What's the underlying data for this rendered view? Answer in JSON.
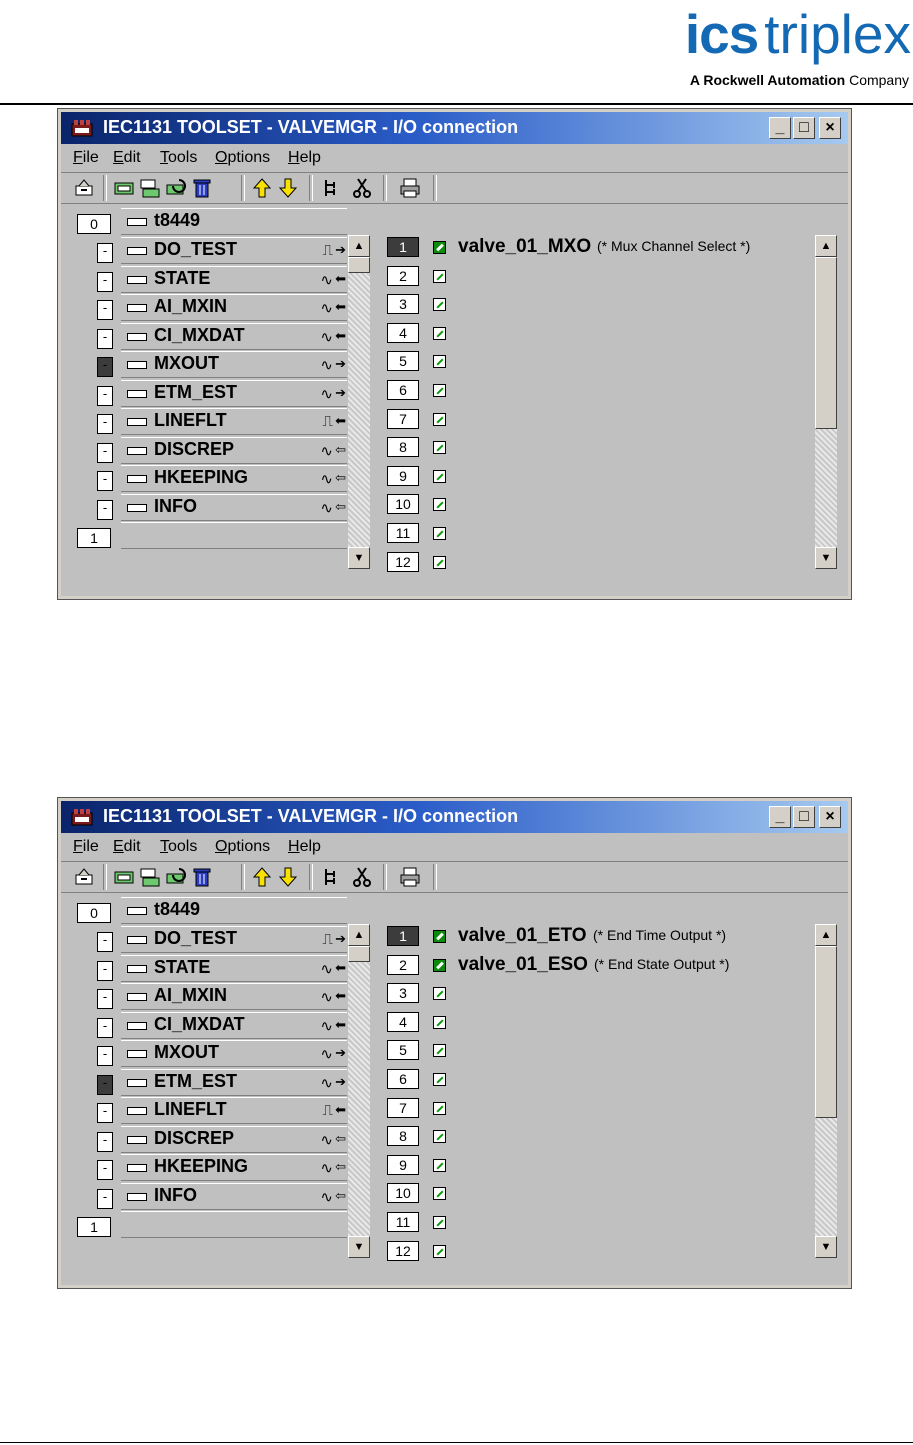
{
  "logo": {
    "brand_bold": "ics",
    "brand_light": "triplex",
    "tagline_bold": "A Rockwell Automation",
    "tagline_light": "Company"
  },
  "window_title": "IEC1131 TOOLSET - VALVEMGR - I/O connection",
  "window_buttons": {
    "minimize": "_",
    "maximize": "□",
    "close": "×"
  },
  "menu": [
    "File",
    "Edit",
    "Tools",
    "Options",
    "Help"
  ],
  "toolbar_icons": [
    "open-icon",
    "board-icon",
    "board-config-icon",
    "board-refresh-icon",
    "delete-icon",
    "up-arrow-icon",
    "down-arrow-icon",
    "tree-icon",
    "cut-icon",
    "print-icon"
  ],
  "tree": {
    "top_index": "0",
    "bottom_index": "1",
    "board": "t8449",
    "items": [
      {
        "label": "DO_TEST",
        "sym": "⎍",
        "dir": "➔"
      },
      {
        "label": "STATE",
        "sym": "∿",
        "dir": "⬅"
      },
      {
        "label": "AI_MXIN",
        "sym": "∿",
        "dir": "⬅"
      },
      {
        "label": "CI_MXDAT",
        "sym": "∿",
        "dir": "⬅"
      },
      {
        "label": "MXOUT",
        "sym": "∿",
        "dir": "➔"
      },
      {
        "label": "ETM_EST",
        "sym": "∿",
        "dir": "➔"
      },
      {
        "label": "LINEFLT",
        "sym": "⎍",
        "dir": "⬅"
      },
      {
        "label": "DISCREP",
        "sym": "∿",
        "dir": "⇦"
      },
      {
        "label": "HKEEPING",
        "sym": "∿",
        "dir": "⇦"
      },
      {
        "label": "INFO",
        "sym": "∿",
        "dir": "⇦"
      }
    ],
    "dash": "-"
  },
  "channels": [
    "1",
    "2",
    "3",
    "4",
    "5",
    "6",
    "7",
    "8",
    "9",
    "10",
    "11",
    "12"
  ],
  "screenshots": [
    {
      "selected_item": 4,
      "connections": [
        {
          "name": "valve_01_MXO",
          "comment": "(* Mux Channel Select *)"
        }
      ]
    },
    {
      "selected_item": 5,
      "connections": [
        {
          "name": "valve_01_ETO",
          "comment": "(* End Time Output *)"
        },
        {
          "name": "valve_01_ESO",
          "comment": "(* End State Output *)"
        }
      ]
    }
  ]
}
